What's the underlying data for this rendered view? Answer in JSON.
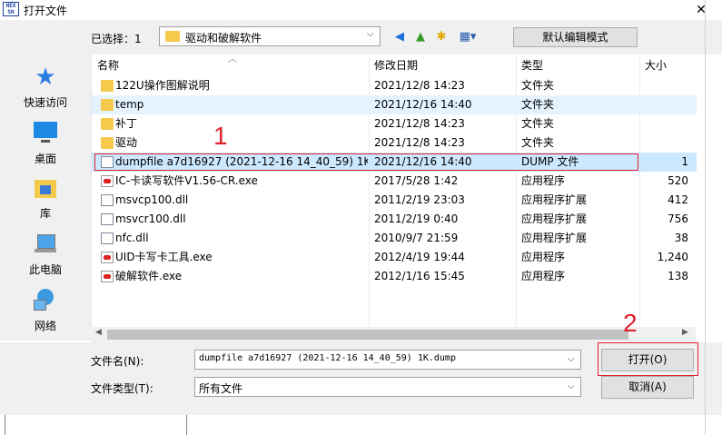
{
  "window": {
    "title": "打开文件",
    "app_icon_text": "HEX\nSNIFF",
    "close_symbol": "✕"
  },
  "toolbar": {
    "selected_label": "已选择：1",
    "path_value": "驱动和破解软件",
    "view_mode_button": "默认编辑模式"
  },
  "sidebar": {
    "items": [
      {
        "label": "快速访问",
        "icon": "star-icon"
      },
      {
        "label": "桌面",
        "icon": "desktop-icon"
      },
      {
        "label": "库",
        "icon": "library-icon"
      },
      {
        "label": "此电脑",
        "icon": "computer-icon"
      },
      {
        "label": "网络",
        "icon": "network-icon"
      }
    ]
  },
  "columns": {
    "name": "名称",
    "date": "修改日期",
    "type": "类型",
    "size": "大小"
  },
  "files": [
    {
      "name": "122U操作图解说明",
      "date": "2021/12/8 14:23",
      "type": "文件夹",
      "size": "",
      "icon": "folder-icon"
    },
    {
      "name": "temp",
      "date": "2021/12/16 14:40",
      "type": "文件夹",
      "size": "",
      "icon": "folder-icon"
    },
    {
      "name": "补丁",
      "date": "2021/12/8 14:23",
      "type": "文件夹",
      "size": "",
      "icon": "folder-icon"
    },
    {
      "name": "驱动",
      "date": "2021/12/8 14:23",
      "type": "文件夹",
      "size": "",
      "icon": "folder-icon"
    },
    {
      "name": "dumpfile a7d16927 (2021-12-16 14_40_59) 1K...",
      "date": "2021/12/16 14:40",
      "type": "DUMP 文件",
      "size": "1",
      "icon": "file-icon"
    },
    {
      "name": "IC-卡读写软件V1.56-CR.exe",
      "date": "2017/5/28 1:42",
      "type": "应用程序",
      "size": "520",
      "icon": "exe-icon"
    },
    {
      "name": "msvcp100.dll",
      "date": "2011/2/19 23:03",
      "type": "应用程序扩展",
      "size": "412",
      "icon": "file-icon"
    },
    {
      "name": "msvcr100.dll",
      "date": "2011/2/19 0:40",
      "type": "应用程序扩展",
      "size": "756",
      "icon": "file-icon"
    },
    {
      "name": "nfc.dll",
      "date": "2010/9/7 21:59",
      "type": "应用程序扩展",
      "size": "38",
      "icon": "file-icon"
    },
    {
      "name": "UID卡写卡工具.exe",
      "date": "2012/4/19 19:44",
      "type": "应用程序",
      "size": "1,240",
      "icon": "exe-icon"
    },
    {
      "name": "破解软件.exe",
      "date": "2012/1/16 15:45",
      "type": "应用程序",
      "size": "138",
      "icon": "exe-icon"
    }
  ],
  "annotations": {
    "step1": "1",
    "step2": "2"
  },
  "bottom": {
    "filename_label": "文件名(N):",
    "filename_value": "dumpfile a7d16927 (2021-12-16 14_40_59) 1K.dump",
    "filetype_label": "文件类型(T):",
    "filetype_value": "所有文件",
    "open_button": "打开(O)",
    "cancel_button": "取消(A)"
  },
  "colors": {
    "selection": "#cce8ff",
    "annotation_red": "#e0202a",
    "folder": "#f4c94c"
  }
}
